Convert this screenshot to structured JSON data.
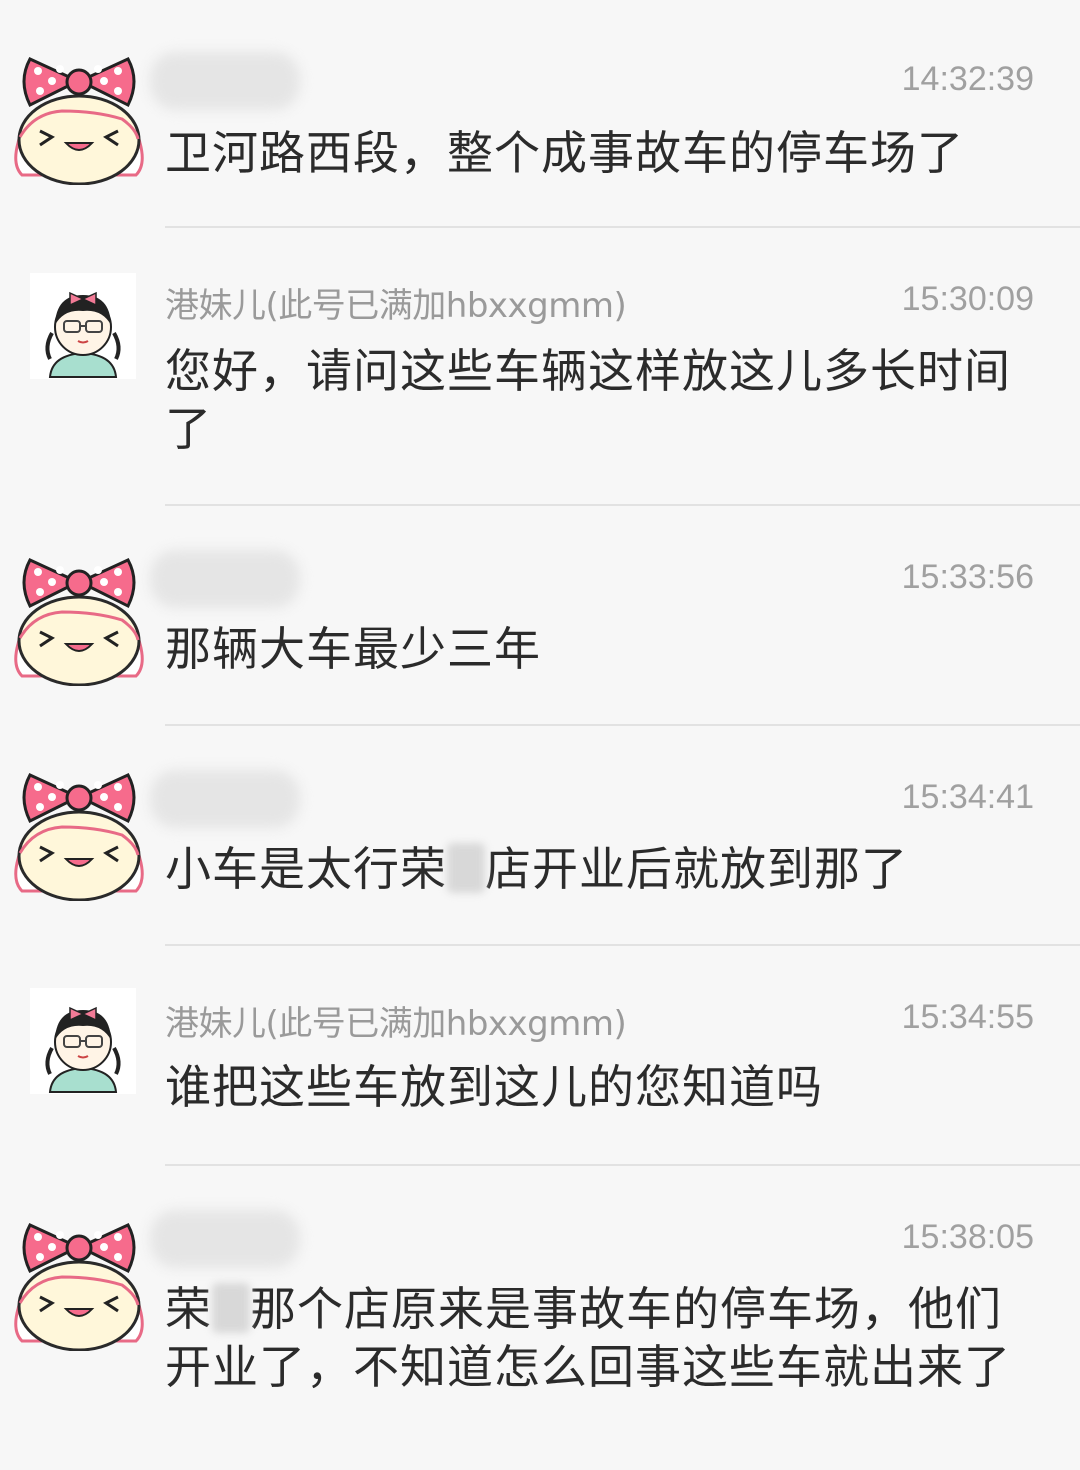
{
  "messages": [
    {
      "avatar": "cartoon-girl-pink-bow-avatar",
      "sender": "",
      "sender_blurred": true,
      "time": "14:32:39",
      "text_parts": [
        "卫河路西段，整个成事故车的停车场了"
      ]
    },
    {
      "avatar": "cartoon-girl-glasses-avatar",
      "sender": "港妹儿(此号已满加hbxxgmm)",
      "sender_blurred": false,
      "time": "15:30:09",
      "text_parts": [
        "您好，请问这些车辆这样放这儿多长时间了"
      ]
    },
    {
      "avatar": "cartoon-girl-pink-bow-avatar",
      "sender": "",
      "sender_blurred": true,
      "time": "15:33:56",
      "text_parts": [
        "那辆大车最少三年"
      ]
    },
    {
      "avatar": "cartoon-girl-pink-bow-avatar",
      "sender": "",
      "sender_blurred": true,
      "time": "15:34:41",
      "text_parts": [
        "小车是太行荣",
        "店开业后就放到那了"
      ]
    },
    {
      "avatar": "cartoon-girl-glasses-avatar",
      "sender": "港妹儿(此号已满加hbxxgmm)",
      "sender_blurred": false,
      "time": "15:34:55",
      "text_parts": [
        "谁把这些车放到这儿的您知道吗"
      ]
    },
    {
      "avatar": "cartoon-girl-pink-bow-avatar",
      "sender": "",
      "sender_blurred": true,
      "time": "15:38:05",
      "text_parts": [
        "荣",
        "那个店原来是事故车的停车场，他们开业了，不知道怎么回事这些车就出来了"
      ]
    }
  ]
}
